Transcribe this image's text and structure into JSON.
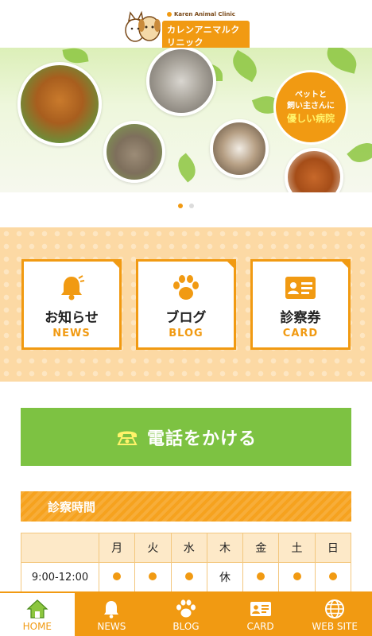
{
  "header": {
    "logo_en": "Karen Animal Clinic",
    "logo_jp": "カレンアニマルクリニック"
  },
  "banner": {
    "badge_line1": "ペットと",
    "badge_line2": "飼い主さんに",
    "badge_line3": "優しい病院",
    "slide_count": 2,
    "active_slide": 1
  },
  "menu": {
    "tiles": [
      {
        "jp": "お知らせ",
        "en": "NEWS",
        "icon": "bell-icon"
      },
      {
        "jp": "ブログ",
        "en": "BLOG",
        "icon": "paw-icon"
      },
      {
        "jp": "診察券",
        "en": "CARD",
        "icon": "id-card-icon"
      }
    ]
  },
  "call": {
    "label": "電話をかける",
    "icon": "phone-icon"
  },
  "hours": {
    "title": "診察時間",
    "days": [
      "月",
      "火",
      "水",
      "木",
      "金",
      "土",
      "日"
    ],
    "rows": [
      {
        "time": "9:00-12:00",
        "cells": [
          "●",
          "●",
          "●",
          "休",
          "●",
          "●",
          "●"
        ]
      }
    ]
  },
  "nav": {
    "items": [
      {
        "label": "HOME",
        "icon": "home-icon",
        "active": true
      },
      {
        "label": "NEWS",
        "icon": "bell-icon",
        "active": false
      },
      {
        "label": "BLOG",
        "icon": "paw-icon",
        "active": false
      },
      {
        "label": "CARD",
        "icon": "id-card-icon",
        "active": false
      },
      {
        "label": "WEB SITE",
        "icon": "globe-icon",
        "active": false
      }
    ]
  },
  "colors": {
    "primary": "#f19a12",
    "green": "#7dc242",
    "menu_bg": "#fcd9a4"
  }
}
